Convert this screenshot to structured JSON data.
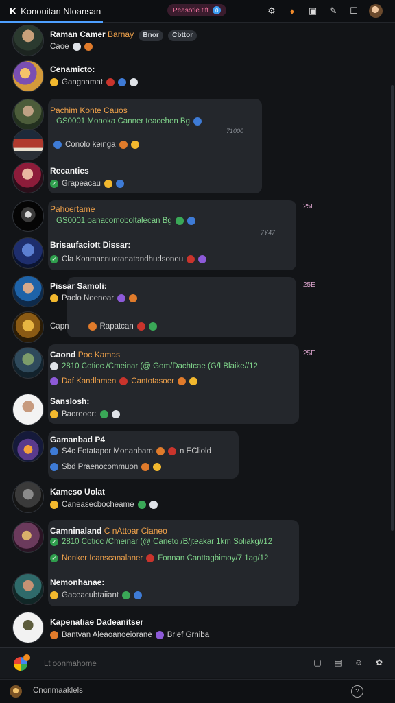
{
  "header": {
    "logo": "K",
    "title": "Konouitan Nloansan",
    "live_pill": "Peasotie tift",
    "live_dot": "0",
    "icons": [
      "settings-icon",
      "fire-icon",
      "cube-icon",
      "tool-icon",
      "window-icon",
      "profile-avatar"
    ]
  },
  "messages": [
    {
      "name": "Raman Camer",
      "name_suffix": "Barnay",
      "chip1": "Bnor",
      "chip2": "Cbttor",
      "sub": "Caoe"
    },
    {
      "name": "Cenamicto:",
      "sub": "Gangnamat"
    },
    {
      "name": "Pachim Konte Cauos",
      "sub": "GS0001 Monoka Canner teacehen Bg"
    },
    {
      "name": "",
      "sub": "Conolo keinga",
      "timestamp": "71000"
    },
    {
      "name": "Recanties",
      "sub": "Grapeacau"
    },
    {
      "name": "Pahoertame",
      "sub": "GS0001 oanacomoboltalecan Bg"
    },
    {
      "name": "Brisaufaciott Dissar:",
      "sub": "Cla Konmacnuotanatandhudsoneu",
      "timestamp": "7Y47"
    },
    {
      "name": "Pissar Samoli:",
      "sub": "Paclo Noenoar"
    },
    {
      "name": "Capn",
      "sub": "Rapatcan"
    },
    {
      "name": "Caond",
      "name_orange": "Poc Kamas",
      "sub": "2810 Cotioc /Cmeinar (@ Gom/Dachtcae (G/I Blaike//12"
    },
    {
      "name": "",
      "sub": "Daf Kandlamen",
      "sub_tail": "Cantotasoer"
    },
    {
      "name": "Sanslosh:",
      "sub": "Baoreoor:"
    },
    {
      "name": "Gamanbad P4",
      "sub": "S4c Fotatapor Monanbam",
      "sub_tail": "n ECliold"
    },
    {
      "name": "",
      "sub": "Sbd Praenocommuon"
    },
    {
      "name": "Kameso Uolat",
      "sub": "Caneasecbocheame"
    },
    {
      "name": "Camninaland",
      "name_orange": "C nAttoar Cianeo",
      "sub": "2810 Cotioc /Cmeinar (@ Caneto /B/jteakar 1km Soliakg//12"
    },
    {
      "name": "",
      "sub": "Nonker Icanscanalaner",
      "sub_tail": "Fonnan Canttagbimoy/7 1ag/12"
    },
    {
      "name": "Nemonhanae:",
      "sub": "Gaceacubtaiiant"
    },
    {
      "name": "Kapenatiae Dadeanitser",
      "sub": "Bantvan Aleaoanoeiorane",
      "sub_tail": "Brief Grniba"
    }
  ],
  "side_badges": [
    "25E",
    "25E",
    "25E"
  ],
  "timestamps": [
    "71000",
    "7Y47"
  ],
  "composer": {
    "placeholder": "Lt oonmahome"
  },
  "bottom": {
    "label": "Cnonmaaklels",
    "help": "?"
  },
  "colors": {
    "accent": "#4ea0ff",
    "card_bg": "#24272c",
    "name_orange": "#f0a24b",
    "green": "#7fd38a"
  }
}
